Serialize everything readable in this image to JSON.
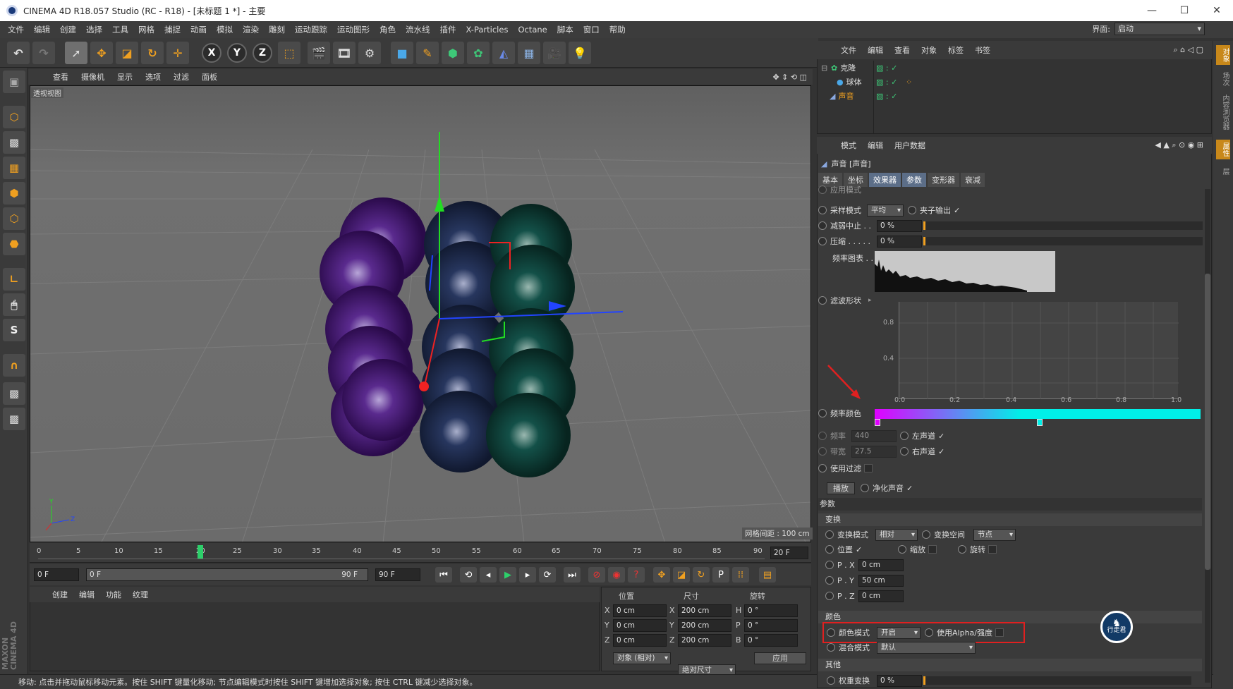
{
  "window": {
    "title": "CINEMA 4D R18.057 Studio (RC - R18) - [未标题 1 *] - 主要"
  },
  "menubar": {
    "items": [
      "文件",
      "编辑",
      "创建",
      "选择",
      "工具",
      "网格",
      "捕捉",
      "动画",
      "模拟",
      "渲染",
      "雕刻",
      "运动跟踪",
      "运动图形",
      "角色",
      "流水线",
      "插件",
      "X-Particles",
      "Octane",
      "脚本",
      "窗口",
      "帮助"
    ],
    "layout_label": "界面:",
    "layout_value": "启动"
  },
  "toolbar": {
    "axis_x": "X",
    "axis_y": "Y",
    "axis_z": "Z"
  },
  "viewport": {
    "menu": [
      "查看",
      "摄像机",
      "显示",
      "选项",
      "过滤",
      "面板"
    ],
    "view_name": "透视视图",
    "grid_spacing": "网格间距 : 100 cm"
  },
  "timeline": {
    "ticks": [
      "0",
      "5",
      "10",
      "15",
      "20",
      "25",
      "30",
      "35",
      "40",
      "45",
      "50",
      "55",
      "60",
      "65",
      "70",
      "75",
      "80",
      "85",
      "90"
    ],
    "current_frame": "20 F",
    "start_field": "0 F",
    "slider_left": "0 F",
    "slider_right": "90 F",
    "end_field": "90 F"
  },
  "material": {
    "menu": [
      "创建",
      "编辑",
      "功能",
      "纹理"
    ]
  },
  "coords": {
    "headers": [
      "位置",
      "尺寸",
      "旋转"
    ],
    "rows": [
      {
        "axis": "X",
        "pos": "0 cm",
        "size_axis": "X",
        "size": "200 cm",
        "rot_axis": "H",
        "rot": "0 °"
      },
      {
        "axis": "Y",
        "pos": "0 cm",
        "size_axis": "Y",
        "size": "200 cm",
        "rot_axis": "P",
        "rot": "0 °"
      },
      {
        "axis": "Z",
        "pos": "0 cm",
        "size_axis": "Z",
        "size": "200 cm",
        "rot_axis": "B",
        "rot": "0 °"
      }
    ],
    "mode": "对象 (相对)",
    "size_mode": "绝对尺寸",
    "apply": "应用"
  },
  "status": "移动: 点击并拖动鼠标移动元素。按住 SHIFT 键量化移动; 节点编辑模式时按住 SHIFT 键增加选择对象; 按住 CTRL 键减少选择对象。",
  "objects": {
    "menu": [
      "文件",
      "编辑",
      "查看",
      "对象",
      "标签",
      "书签"
    ],
    "items": [
      {
        "name": "克隆"
      },
      {
        "name": "球体"
      },
      {
        "name": "声音"
      }
    ]
  },
  "attributes": {
    "menu": [
      "模式",
      "编辑",
      "用户数据"
    ],
    "object_title": "声音 [声音]",
    "tabs": [
      "基本",
      "坐标",
      "效果器",
      "参数",
      "变形器",
      "衰减"
    ],
    "partial_row": "应用模式",
    "sample_mode_label": "采样模式",
    "sample_mode_value": "平均",
    "clamp_output": "夹子输出",
    "attenuation_label": "减弱中止 . .",
    "attenuation_value": "0 %",
    "compress_label": "压缩 . . . . .",
    "compress_value": "0 %",
    "spectrum_label": "频率图表 . .",
    "filter_shape_label": "滤波形状",
    "graph_y": [
      "0.8",
      "0.4"
    ],
    "graph_x": [
      "0.0",
      "0.2",
      "0.4",
      "0.6",
      "0.8",
      "1.0"
    ],
    "freq_color_label": "频率颜色",
    "freq_label": "频率",
    "freq_value": "440",
    "bandwidth_label": "带宽",
    "bandwidth_value": "27.5",
    "left_channel": "左声道",
    "right_channel": "右声道",
    "use_filter": "使用过滤",
    "play_button": "播放",
    "clean_sound": "净化声音",
    "params_header": "参数",
    "transform_section": "变换",
    "transform_mode_label": "变换模式",
    "transform_mode_value": "相对",
    "transform_space_label": "变换空间",
    "transform_space_value": "节点",
    "position_label": "位置",
    "scale_label": "缩放",
    "rotate_label": "旋转",
    "px_label": "P . X",
    "px_value": "0 cm",
    "py_label": "P . Y",
    "py_value": "50 cm",
    "pz_label": "P . Z",
    "pz_value": "0 cm",
    "color_section": "颜色",
    "color_mode_label": "颜色模式",
    "color_mode_value": "开启",
    "use_alpha_label": "使用Alpha/强度",
    "blend_mode_label": "混合模式",
    "blend_mode_value": "默认",
    "other_section": "其他",
    "weight_label": "权重变换",
    "weight_value": "0 %"
  },
  "sidetabs": [
    "对象",
    "场次",
    "内容浏览器",
    "属性",
    "层"
  ],
  "badge": {
    "text": "行走君"
  },
  "colors": {
    "accent": "#f0a020",
    "gradient_start": "#e000ff",
    "gradient_end": "#00f0e8",
    "highlight_box": "#e02020"
  }
}
